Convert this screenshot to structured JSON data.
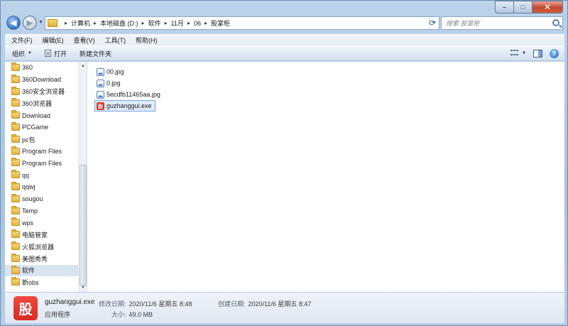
{
  "titlebar": {
    "ghost_tabs": [
      "",
      "",
      "",
      ""
    ],
    "buttons": {
      "minimize": "–",
      "maximize": "□",
      "close": "✕"
    }
  },
  "navigation": {
    "back_icon": "back-arrow-icon",
    "forward_icon": "forward-arrow-icon",
    "breadcrumb": [
      "计算机",
      "本地磁盘 (D:)",
      "软件",
      "11月",
      "06",
      "股掌柜"
    ],
    "search_placeholder": "搜索 股掌柜"
  },
  "menubar": {
    "items": [
      "文件(F)",
      "编辑(E)",
      "查看(V)",
      "工具(T)",
      "帮助(H)"
    ]
  },
  "toolbar": {
    "organize": "组织",
    "open": "打开",
    "new_folder": "新建文件夹"
  },
  "sidebar": {
    "items": [
      {
        "label": "360"
      },
      {
        "label": "360Download"
      },
      {
        "label": "360安全浏览器"
      },
      {
        "label": "360浏览器"
      },
      {
        "label": "Download"
      },
      {
        "label": "PCGame"
      },
      {
        "label": "pc包"
      },
      {
        "label": "Program Files"
      },
      {
        "label": "Program Files"
      },
      {
        "label": "qq"
      },
      {
        "label": "qqwj"
      },
      {
        "label": "sougou"
      },
      {
        "label": "Temp"
      },
      {
        "label": "wps"
      },
      {
        "label": "电脑管家"
      },
      {
        "label": "火狐浏览器"
      },
      {
        "label": "美图秀秀"
      },
      {
        "label": "软件"
      },
      {
        "label": "新obs"
      }
    ],
    "selected_index": 17
  },
  "files": [
    {
      "name": "00.jpg",
      "type": "image"
    },
    {
      "name": "0.jpg",
      "type": "image"
    },
    {
      "name": "5ecdfb11465aa.jpg",
      "type": "image"
    },
    {
      "name": "guzhanggui.exe",
      "type": "exe"
    }
  ],
  "details": {
    "icon_glyph": "股",
    "file_name": "guzhanggui.exe",
    "file_type": "应用程序",
    "modified_label": "修改日期:",
    "modified_value": "2020/11/6 星期五 8:48",
    "created_label": "创建日期:",
    "created_value": "2020/11/6 星期五 8:47",
    "size_label": "大小:",
    "size_value": "49.0 MB"
  },
  "colors": {
    "exe_icon": "#e0332b",
    "selection": "#dfeafa",
    "selection_border": "#7aa7dc"
  }
}
